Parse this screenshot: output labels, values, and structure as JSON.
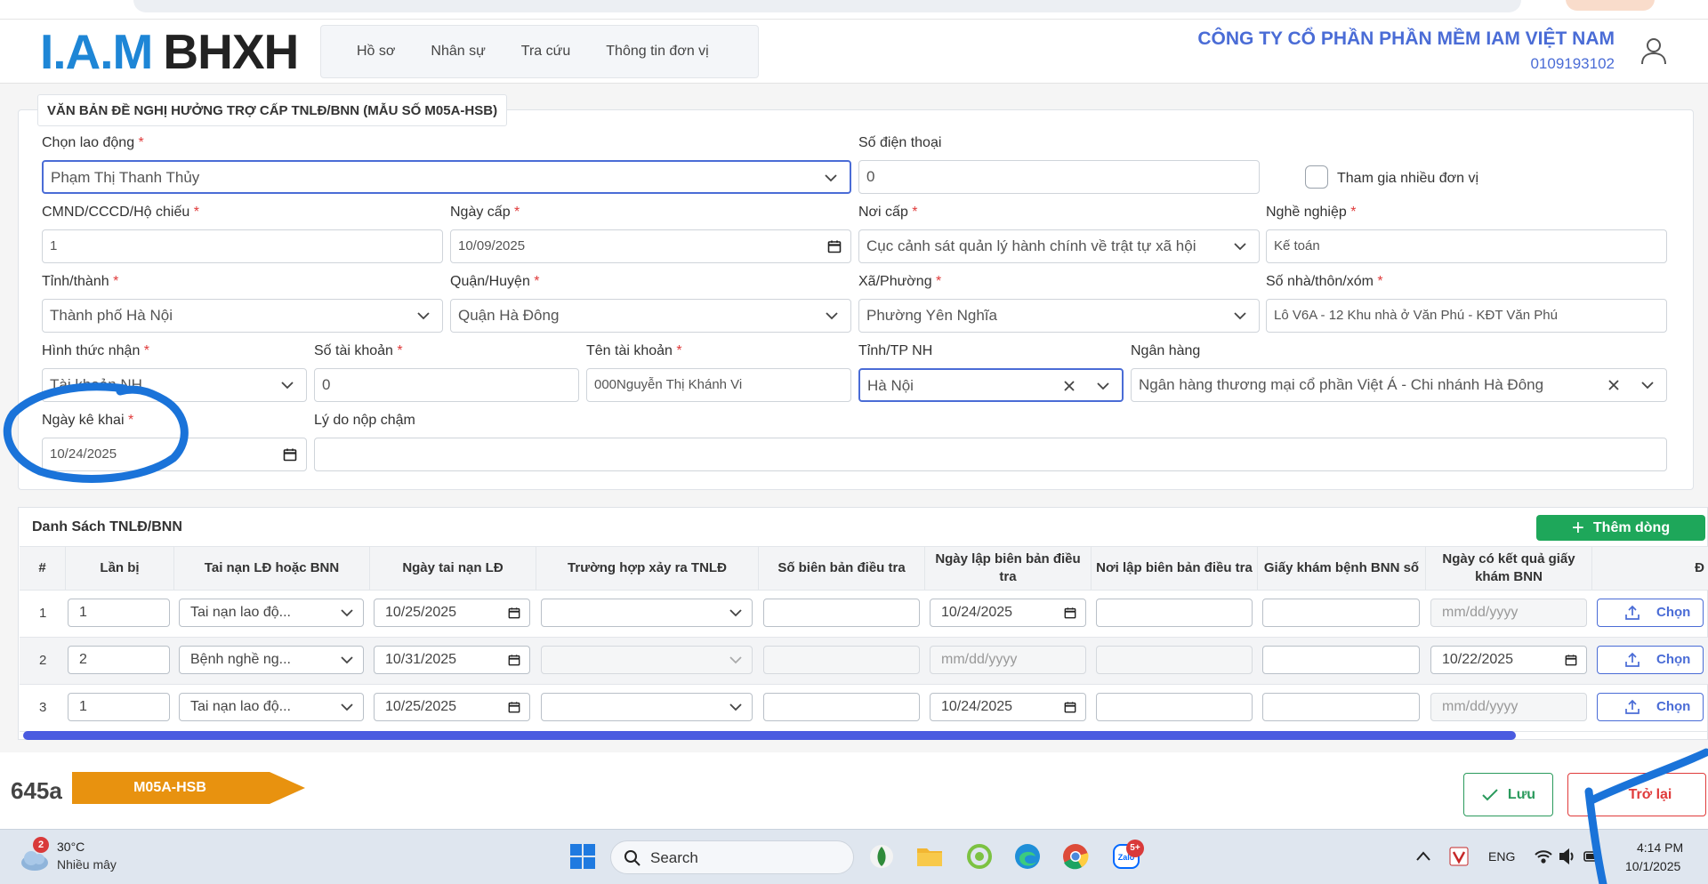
{
  "header": {
    "logo_iam": "I.A.M",
    "logo_bhxh": "BHXH",
    "nav": [
      "Hồ sơ",
      "Nhân sự",
      "Tra cứu",
      "Thông tin đơn vị"
    ],
    "company_name": "CÔNG TY CỔ PHẦN PHẦN MỀM IAM VIỆT NAM",
    "company_tax": "0109193102"
  },
  "form": {
    "title": "VĂN BẢN ĐỀ NGHỊ HƯỞNG TRỢ CẤP TNLĐ/BNN (MẪU SỐ M05A-HSB)",
    "required_mark": "*",
    "employee": {
      "label": "Chọn lao động",
      "value": "Phạm Thị Thanh Thủy"
    },
    "phone": {
      "label": "Số điện thoại",
      "value": "0"
    },
    "multi_unit": {
      "label": "Tham gia nhiều đơn vị"
    },
    "id_number": {
      "label": "CMND/CCCD/Hộ chiếu",
      "value": "1"
    },
    "issue_date": {
      "label": "Ngày cấp",
      "value": "10/09/2025"
    },
    "issue_place": {
      "label": "Nơi cấp",
      "value": "Cục cảnh sát quản lý hành chính về trật tự xã hội"
    },
    "occupation": {
      "label": "Nghề nghiệp",
      "value": "Kế toán"
    },
    "province": {
      "label": "Tỉnh/thành",
      "value": "Thành phố Hà Nội"
    },
    "district": {
      "label": "Quận/Huyện",
      "value": "Quận Hà Đông"
    },
    "ward": {
      "label": "Xã/Phường",
      "value": "Phường Yên Nghĩa"
    },
    "address": {
      "label": "Số nhà/thôn/xóm",
      "value": "Lô V6A - 12 Khu nhà ở Văn Phú - KĐT Văn Phú"
    },
    "receive_method": {
      "label": "Hình thức nhận",
      "value": "Tài khoản NH"
    },
    "account_number": {
      "label": "Số tài khoản",
      "value": "0"
    },
    "account_name": {
      "label": "Tên tài khoản",
      "value": "000Nguyễn Thị Khánh Vi"
    },
    "bank_province": {
      "label": "Tỉnh/TP NH",
      "value": "Hà Nội"
    },
    "bank": {
      "label": "Ngân hàng",
      "value": "Ngân hàng thương mại cổ phần Việt Á - Chi nhánh Hà Đông"
    },
    "declare_date": {
      "label": "Ngày kê khai",
      "value": "10/24/2025"
    },
    "late_reason": {
      "label": "Lý do nộp chậm",
      "value": ""
    }
  },
  "table": {
    "title": "Danh Sách TNLĐ/BNN",
    "add_label": "Thêm dòng",
    "columns": [
      "#",
      "Lần bị",
      "Tai nạn LĐ hoặc BNN",
      "Ngày tai nạn LĐ",
      "Trường hợp xảy ra TNLĐ",
      "Số biên bản điều tra",
      "Ngày lập biên bản điều tra",
      "Nơi lập biên bản điều tra",
      "Giấy khám bệnh BNN số",
      "Ngày có kết quả giấy khám BNN",
      "Đ"
    ],
    "date_placeholder": "mm/dd/yyyy",
    "upload_label": "Chọn",
    "rows": [
      {
        "num": "1",
        "times": "1",
        "type": "Tai nạn lao độ...",
        "accident_date": "10/25/2025",
        "report_date": "10/24/2025",
        "exam_date": ""
      },
      {
        "num": "2",
        "times": "2",
        "type": "Bệnh nghề ng...",
        "accident_date": "10/31/2025",
        "report_date": "",
        "exam_date": "10/22/2025"
      },
      {
        "num": "3",
        "times": "1",
        "type": "Tai nạn lao độ...",
        "accident_date": "10/25/2025",
        "report_date": "10/24/2025",
        "exam_date": ""
      }
    ]
  },
  "footer": {
    "code": "645a",
    "tag": "M05A-HSB",
    "save_label": "Lưu",
    "back_label": "Trở lại"
  },
  "taskbar": {
    "weather_badge": "2",
    "temperature": "30°C",
    "weather": "Nhiều mây",
    "search_label": "Search",
    "zalo_badge": "5+",
    "language": "ENG",
    "time": "4:14 PM",
    "date": "10/1/2025"
  },
  "colors": {
    "brand_blue": "#1e86d6",
    "accent": "#4a6cd6",
    "required": "#e03b3b",
    "success": "#1ea75a",
    "tag_orange": "#e8920f",
    "annotation_blue": "#1a73d9"
  }
}
